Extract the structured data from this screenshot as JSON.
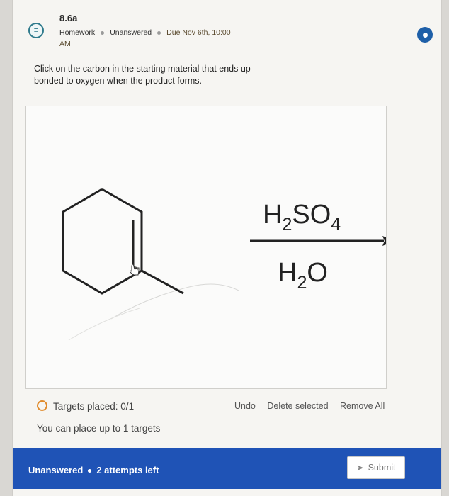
{
  "question": {
    "title": "8.6a",
    "category": "Homework",
    "status": "Unanswered",
    "due_line1": "Due Nov 6th, 10:00",
    "due_line2": "AM",
    "prompt": "Click on the carbon in the starting material that ends up bonded to oxygen when the product forms."
  },
  "reagents": {
    "above_arrow": {
      "h": "H",
      "sub1": "2",
      "so": "SO",
      "sub2": "4"
    },
    "below_arrow": {
      "h": "H",
      "sub": "2",
      "o": "O"
    }
  },
  "targets": {
    "placed_label": "Targets placed: 0/1",
    "limit_label": "You can place up to 1 targets"
  },
  "actions": {
    "undo": "Undo",
    "delete_selected": "Delete selected",
    "remove_all": "Remove All"
  },
  "footer": {
    "status": "Unanswered",
    "attempts": "2 attempts left",
    "submit": "Submit"
  },
  "colors": {
    "footer_bg": "#1f53b6",
    "accent": "#1e5fa8",
    "target_ring": "#e08a2b"
  }
}
